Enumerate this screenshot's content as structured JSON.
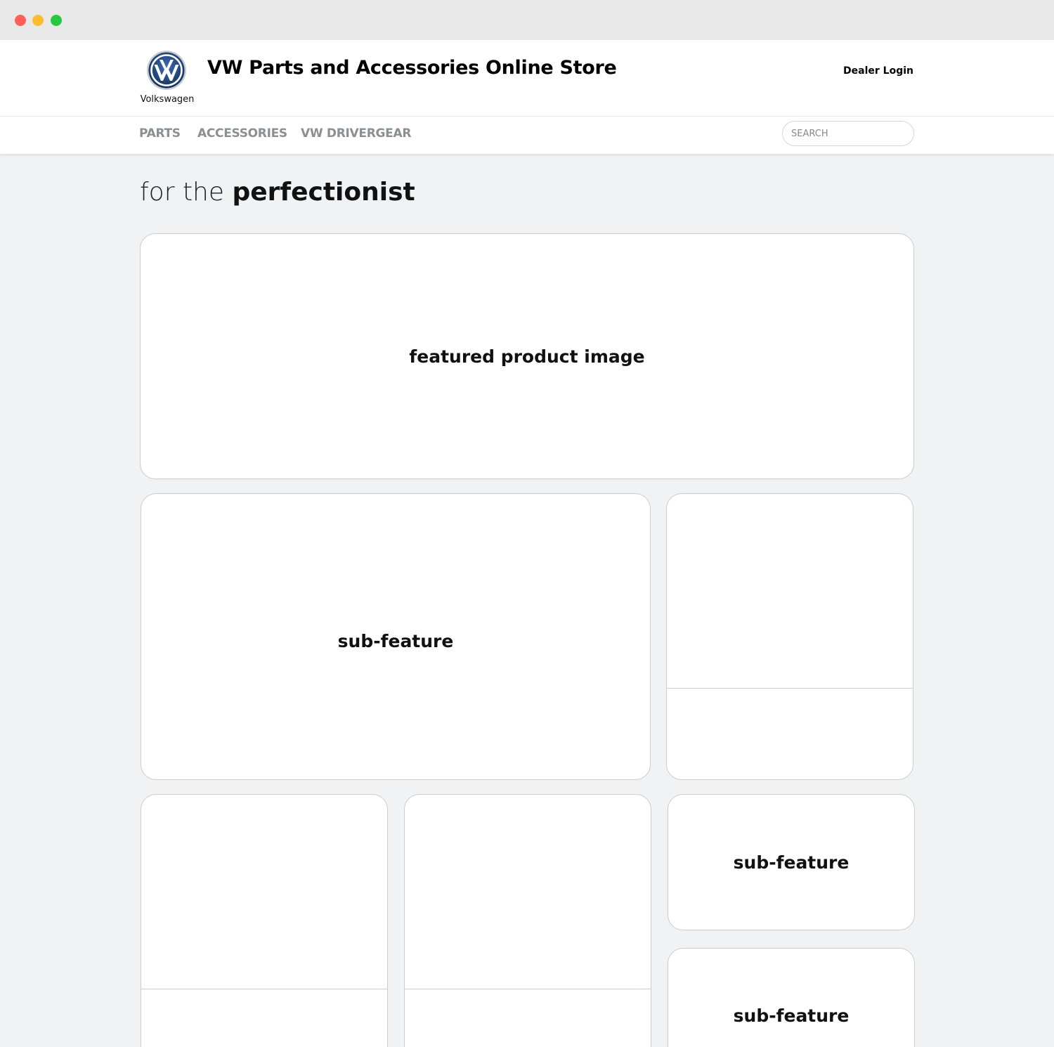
{
  "brand": {
    "name": "Volkswagen",
    "logo_icon": "vw-logo-icon",
    "colors": {
      "logo_blue": "#1b3a6e",
      "nav_gray": "#8a8f93"
    }
  },
  "header": {
    "title": "VW Parts and Accessories Online Store",
    "dealer_login": "Dealer Login"
  },
  "nav": {
    "items": [
      {
        "label": "PARTS"
      },
      {
        "label": "ACCESSORIES"
      },
      {
        "label": "VW DRIVERGEAR"
      }
    ],
    "search": {
      "placeholder": "SEARCH",
      "value": ""
    }
  },
  "main": {
    "headline": {
      "prefix": "for the",
      "emphasis": "perfectionist"
    },
    "featured": {
      "label": "featured product image"
    },
    "sub_features": [
      {
        "label": "sub-feature"
      },
      {
        "label": ""
      },
      {
        "label": ""
      },
      {
        "label": ""
      },
      {
        "label": "sub-feature"
      },
      {
        "label": "sub-feature"
      }
    ]
  }
}
